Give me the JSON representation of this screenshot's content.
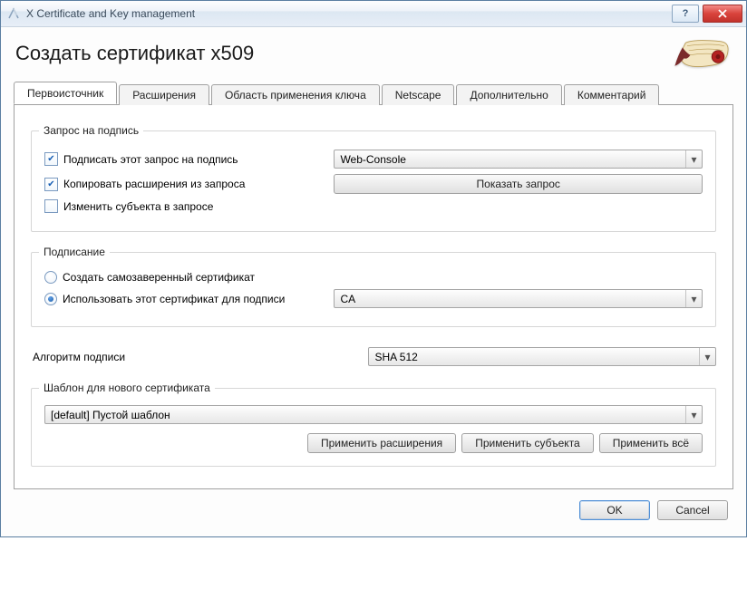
{
  "window_title": "X Certificate and Key management",
  "page_title": "Создать сертификат x509",
  "tabs": [
    {
      "label": "Первоисточник"
    },
    {
      "label": "Расширения"
    },
    {
      "label": "Область применения ключа"
    },
    {
      "label": "Netscape"
    },
    {
      "label": "Дополнительно"
    },
    {
      "label": "Комментарий"
    }
  ],
  "active_tab": 0,
  "sign_request": {
    "legend": "Запрос на подпись",
    "sign_checkbox_label": "Подписать этот запрос на подпись",
    "sign_checkbox_checked": true,
    "copy_ext_label": "Копировать расширения из запроса",
    "copy_ext_checked": true,
    "modify_subject_label": "Изменить субъекта в запросе",
    "modify_subject_checked": false,
    "request_select_value": "Web-Console",
    "show_request_button": "Показать запрос"
  },
  "signing": {
    "legend": "Подписание",
    "self_signed_label": "Создать самозаверенный сертификат",
    "use_cert_label": "Использовать этот сертификат для подписи",
    "radio_selected": "use_cert",
    "cert_select_value": "CA"
  },
  "algorithm": {
    "label": "Алгоритм подписи",
    "value": "SHA 512"
  },
  "template": {
    "legend": "Шаблон для нового сертификата",
    "value": "[default] Пустой шаблон",
    "apply_ext_button": "Применить расширения",
    "apply_subj_button": "Применить субъекта",
    "apply_all_button": "Применить всё"
  },
  "dialog": {
    "ok": "OK",
    "cancel": "Cancel"
  }
}
